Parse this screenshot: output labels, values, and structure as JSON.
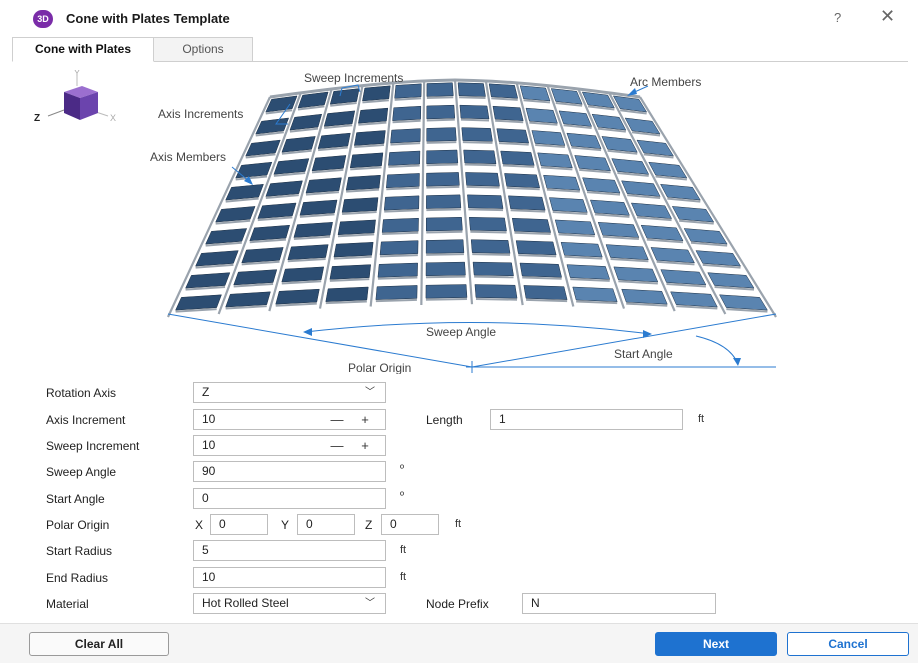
{
  "window": {
    "app_badge": "3D",
    "title": "Cone with Plates Template",
    "help_glyph": "?",
    "close_glyph": "✕"
  },
  "tabs": [
    {
      "label": "Cone with Plates",
      "active": true
    },
    {
      "label": "Options",
      "active": false
    }
  ],
  "triad": {
    "y": "Y",
    "z": "Z",
    "x": "X"
  },
  "diagram": {
    "labels": {
      "sweep_increments": "Sweep Increments",
      "arc_members": "Arc Members",
      "axis_increments": "Axis Increments",
      "axis_members": "Axis Members",
      "sweep_angle": "Sweep Angle",
      "start_angle": "Start Angle",
      "polar_origin": "Polar Origin"
    },
    "colors": {
      "plate": "#3f6590",
      "plate_dark": "#2c4d72",
      "plate_light": "#5a84b0",
      "edge": "#9aa3ad",
      "annotation": "#2b7bd0"
    }
  },
  "form": {
    "rotation_axis": {
      "label": "Rotation Axis",
      "value": "Z",
      "caret": "﹀"
    },
    "axis_increment": {
      "label": "Axis Increment",
      "value": "10",
      "minus": "—",
      "plus": "+"
    },
    "length": {
      "label": "Length",
      "value": "1",
      "unit": "ft"
    },
    "sweep_increment": {
      "label": "Sweep Increment",
      "value": "10",
      "minus": "—",
      "plus": "+"
    },
    "sweep_angle": {
      "label": "Sweep Angle",
      "value": "90",
      "unit": "º"
    },
    "start_angle": {
      "label": "Start Angle",
      "value": "0",
      "unit": "º"
    },
    "polar_origin": {
      "label": "Polar Origin",
      "x_label": "X",
      "x": "0",
      "y_label": "Y",
      "y": "0",
      "z_label": "Z",
      "z": "0",
      "unit": "ft"
    },
    "start_radius": {
      "label": "Start Radius",
      "value": "5",
      "unit": "ft"
    },
    "end_radius": {
      "label": "End Radius",
      "value": "10",
      "unit": "ft"
    },
    "material": {
      "label": "Material",
      "value": "Hot Rolled Steel",
      "caret": "﹀"
    },
    "node_prefix": {
      "label": "Node Prefix",
      "value": "N"
    }
  },
  "footer": {
    "clear_all": "Clear All",
    "next": "Next",
    "cancel": "Cancel"
  }
}
